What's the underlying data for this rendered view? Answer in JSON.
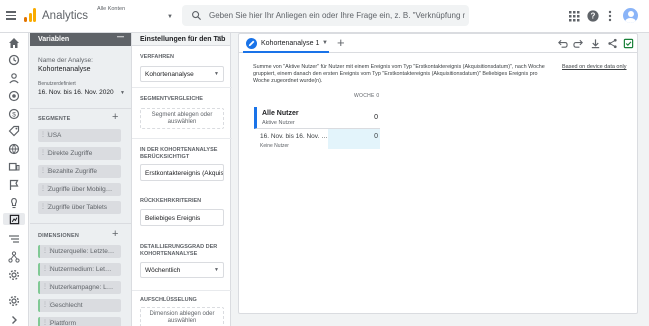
{
  "header": {
    "app_title": "Analytics",
    "account_label": "Alle Konten",
    "account_value": "",
    "search_placeholder": "Geben Sie hier Ihr Anliegen ein oder Ihre Frage ein, z. B. \"Verknüpfung mit G…"
  },
  "rail": {
    "icons": [
      "home-icon",
      "clock-icon",
      "person-icon",
      "target-icon",
      "info-icon",
      "tag-icon",
      "globe-icon",
      "screen-icon",
      "flag-icon",
      "bulb-icon",
      "explore-icon",
      "audience-icon",
      "branch-icon",
      "settings-icon",
      "admin-icon",
      "expand-icon"
    ]
  },
  "variables": {
    "title": "Variablen",
    "analysis_name_label": "Name der Analyse:",
    "analysis_name": "Kohortenanalyse",
    "date_type": "Benutzerdefiniert",
    "date_range": "16. Nov. bis 16. Nov. 2020",
    "segments_label": "SEGMENTE",
    "segments": [
      "USA",
      "Direkte Zugriffe",
      "Bezahlte Zugriffe",
      "Zugriffe über Mobilg…",
      "Zugriffe über Tablets"
    ],
    "dimensions_label": "DIMENSIONEN",
    "dimensions": [
      "Nutzerquelle: Letzte…",
      "Nutzermedium: Let…",
      "Nutzerkampagne: L…",
      "Geschlecht",
      "Plattform"
    ]
  },
  "settings": {
    "title": "Einstellungen für den Tab",
    "technique_label": "VERFAHREN",
    "technique": "Kohortenanalyse",
    "segment_compare_label": "SEGMENTVERGLEICHE",
    "segment_drop": "Segment ablegen oder auswählen",
    "inclusion_label": "IN DER KOHORTENANALYSE BERÜCKSICHTIGT",
    "inclusion": "Erstkontaktereignis (Akquisit",
    "return_label": "RÜCKKEHRKRITERIEN",
    "return": "Beliebiges Ereignis",
    "granularity_label": "DETAILLIERUNGSGRAD DER KOHORTENANALYSE",
    "granularity": "Wöchentlich",
    "breakdown_label": "AUFSCHLÜSSELUNG",
    "breakdown_drop": "Dimension ablegen oder auswählen"
  },
  "canvas": {
    "tab_label": "Kohortenanalyse 1",
    "description": "Summe von \"Aktive Nutzer\" für Nutzer mit einem Ereignis vom Typ \"Erstkontaktereignis (Akquisitionsdatum)\", nach Woche gruppiert, einem danach den ersten Ereignis vom Typ \"Erstkontaktereignis (Akquisitionsdatum)\" Beliebiges Ereignis pro Woche zugeordnet wurde(n).",
    "device_link": "Based on device data only",
    "week_header": "WOCHE 0",
    "total_title": "Alle Nutzer",
    "total_sub": "Aktive Nutzer",
    "total_value": "0",
    "row_label": "16. Nov. bis 16. Nov. …",
    "row_sub": "Keine Nutzer",
    "row_value": "0"
  }
}
